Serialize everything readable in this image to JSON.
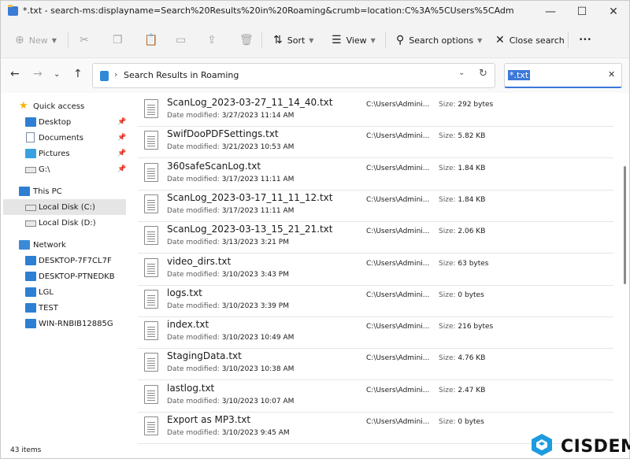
{
  "window": {
    "title": "*.txt - search-ms:displayname=Search%20Results%20in%20Roaming&crumb=location:C%3A%5CUsers%5CAdm",
    "minimize_glyph": "—",
    "maximize_glyph": "☐",
    "close_glyph": "✕"
  },
  "commandbar": {
    "new_label": "New",
    "sort_label": "Sort",
    "view_label": "View",
    "search_options_label": "Search options",
    "close_search_label": "Close search",
    "more_glyph": "•••"
  },
  "address": {
    "breadcrumb": "Search Results in Roaming",
    "search_value": "*.txt"
  },
  "navpane": {
    "quick_access": "Quick access",
    "items": [
      {
        "label": "Desktop",
        "icon": "desktop-icon",
        "pinned": true
      },
      {
        "label": "Documents",
        "icon": "documents-icon",
        "pinned": true
      },
      {
        "label": "Pictures",
        "icon": "pictures-icon",
        "pinned": true
      },
      {
        "label": "G:\\",
        "icon": "drive-icon",
        "pinned": true
      }
    ],
    "this_pc": "This PC",
    "drives": [
      {
        "label": "Local Disk (C:)",
        "selected": true
      },
      {
        "label": "Local Disk (D:)",
        "selected": false
      }
    ],
    "network": "Network",
    "network_items": [
      "DESKTOP-7F7CL7F",
      "DESKTOP-PTNEDKB",
      "LGL",
      "TEST",
      "WIN-RNBIB12885G"
    ]
  },
  "labels": {
    "date_modified": "Date modified:",
    "size": "Size:"
  },
  "files": [
    {
      "name": "ScanLog_2023-03-27_11_14_40.txt",
      "date": "3/27/2023 11:14 AM",
      "path": "C:\\Users\\Admini...",
      "size": "292 bytes"
    },
    {
      "name": "SwifDooPDFSettings.txt",
      "date": "3/21/2023 10:53 AM",
      "path": "C:\\Users\\Admini...",
      "size": "5.82 KB"
    },
    {
      "name": "360safeScanLog.txt",
      "date": "3/17/2023 11:11 AM",
      "path": "C:\\Users\\Admini...",
      "size": "1.84 KB"
    },
    {
      "name": "ScanLog_2023-03-17_11_11_12.txt",
      "date": "3/17/2023 11:11 AM",
      "path": "C:\\Users\\Admini...",
      "size": "1.84 KB"
    },
    {
      "name": "ScanLog_2023-03-13_15_21_21.txt",
      "date": "3/13/2023 3:21 PM",
      "path": "C:\\Users\\Admini...",
      "size": "2.06 KB"
    },
    {
      "name": "video_dirs.txt",
      "date": "3/10/2023 3:43 PM",
      "path": "C:\\Users\\Admini...",
      "size": "63 bytes"
    },
    {
      "name": "logs.txt",
      "date": "3/10/2023 3:39 PM",
      "path": "C:\\Users\\Admini...",
      "size": "0 bytes"
    },
    {
      "name": "index.txt",
      "date": "3/10/2023 10:49 AM",
      "path": "C:\\Users\\Admini...",
      "size": "216 bytes"
    },
    {
      "name": "StagingData.txt",
      "date": "3/10/2023 10:38 AM",
      "path": "C:\\Users\\Admini...",
      "size": "4.76 KB"
    },
    {
      "name": "lastlog.txt",
      "date": "3/10/2023 10:07 AM",
      "path": "C:\\Users\\Admini...",
      "size": "2.47 KB"
    },
    {
      "name": "Export as MP3.txt",
      "date": "3/10/2023 9:45 AM",
      "path": "C:\\Users\\Admini...",
      "size": "0 bytes"
    }
  ],
  "status": {
    "count": "43 items"
  },
  "watermark": {
    "text": "CISDEM",
    "color": "#1e9be0"
  }
}
